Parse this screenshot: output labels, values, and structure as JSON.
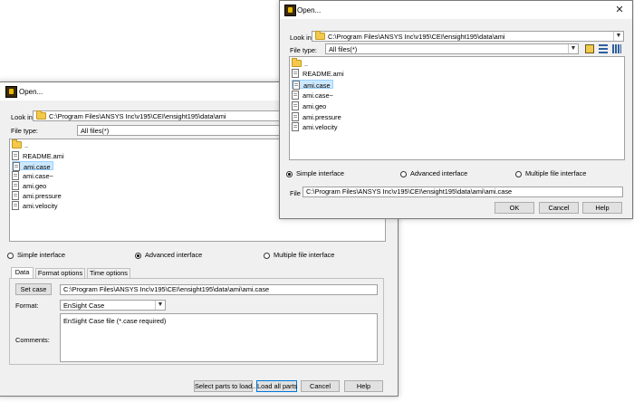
{
  "back_dialog": {
    "title": "Open...",
    "look_in_label": "Look in:",
    "look_in_value": "C:\\Program Files\\ANSYS Inc\\v195\\CEI\\ensight195\\data\\ami",
    "file_type_label": "File type:",
    "file_type_value": "All files(*)",
    "files": [
      "..",
      "README.ami",
      "ami.case",
      "ami.case~",
      "ami.geo",
      "ami.pressure",
      "ami.velocity"
    ],
    "selected_file": "ami.case",
    "radios": [
      "Simple interface",
      "Advanced interface",
      "Multiple file interface"
    ],
    "selected_radio": "Advanced interface",
    "tabs": [
      "Data",
      "Format options",
      "Time options"
    ],
    "active_tab": "Data",
    "set_case_label": "Set case",
    "set_case_value": "C:\\Program Files\\ANSYS Inc\\v195\\CEI\\ensight195\\data\\ami\\ami.case",
    "format_label": "Format:",
    "format_value": "EnSight Case",
    "comments_label": "Comments:",
    "comments_value": "EnSight Case file (*.case required)",
    "buttons": [
      "Select parts to load...",
      "Load all parts",
      "Cancel",
      "Help"
    ]
  },
  "front_dialog": {
    "title": "Open...",
    "close_glyph": "✕",
    "look_in_label": "Look in:",
    "look_in_value": "C:\\Program Files\\ANSYS Inc\\v195\\CEI\\ensight195\\data\\ami",
    "file_type_label": "File type:",
    "file_type_value": "All files(*)",
    "files": [
      "..",
      "README.ami",
      "ami.case",
      "ami.case~",
      "ami.geo",
      "ami.pressure",
      "ami.velocity"
    ],
    "selected_file": "ami.case",
    "radios": [
      "Simple interface",
      "Advanced interface",
      "Multiple file interface"
    ],
    "selected_radio": "Simple interface",
    "file_label": "File",
    "file_value": "C:\\Program Files\\ANSYS Inc\\v195\\CEI\\ensight195\\data\\ami\\ami.case",
    "buttons": [
      "OK",
      "Cancel",
      "Help"
    ]
  },
  "colors": {
    "selection": "#cce8ff",
    "default_button_border": "#0078d7",
    "dialog_bg": "#f0f0f0"
  }
}
